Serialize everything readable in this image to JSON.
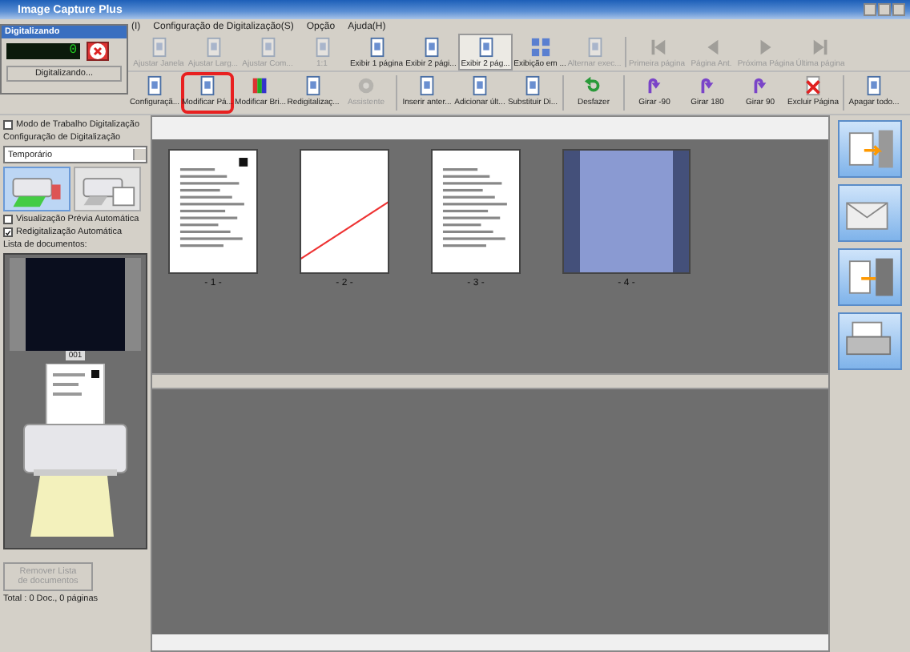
{
  "window": {
    "title": "Image Capture Plus"
  },
  "menu": [
    "(I)",
    "Configuração de Digitalização(S)",
    "Opção",
    "Ajuda(H)"
  ],
  "toolbar_view": [
    {
      "label": "Ajustar Janela",
      "disabled": true,
      "selected": false
    },
    {
      "label": "Ajustar Larg...",
      "disabled": true,
      "selected": false
    },
    {
      "label": "Ajustar Com...",
      "disabled": true,
      "selected": false
    },
    {
      "label": "1:1",
      "disabled": true,
      "selected": false
    },
    {
      "label": "Exibir 1 página",
      "disabled": false,
      "selected": false
    },
    {
      "label": "Exibir 2 pági...",
      "disabled": false,
      "selected": false
    },
    {
      "label": "Exibir 2 pág...",
      "disabled": false,
      "selected": true
    },
    {
      "label": "Exibição em ...",
      "disabled": false,
      "selected": false
    },
    {
      "label": "Alternar exec...",
      "disabled": true,
      "selected": false
    },
    {
      "label": "Primeira página",
      "disabled": true,
      "selected": false
    },
    {
      "label": "Página Ant.",
      "disabled": true,
      "selected": false
    },
    {
      "label": "Próxima Página",
      "disabled": true,
      "selected": false
    },
    {
      "label": "Última página",
      "disabled": true,
      "selected": false
    }
  ],
  "toolbar_edit": [
    {
      "label": "Configuraçã...",
      "disabled": false,
      "marked": false
    },
    {
      "label": "Modificar Pá...",
      "disabled": false,
      "marked": true
    },
    {
      "label": "Modificar Bri...",
      "disabled": false,
      "marked": false
    },
    {
      "label": "Redigitalizaç...",
      "disabled": false,
      "marked": false
    },
    {
      "label": "Assistente",
      "disabled": true,
      "marked": false
    },
    {
      "label": "Inserir anter...",
      "disabled": false,
      "marked": false
    },
    {
      "label": "Adicionar últ...",
      "disabled": false,
      "marked": false
    },
    {
      "label": "Substituir Di...",
      "disabled": false,
      "marked": false
    },
    {
      "label": "Desfazer",
      "disabled": false,
      "marked": false
    },
    {
      "label": "Girar -90",
      "disabled": false,
      "marked": false
    },
    {
      "label": "Girar 180",
      "disabled": false,
      "marked": false
    },
    {
      "label": "Girar 90",
      "disabled": false,
      "marked": false
    },
    {
      "label": "Excluir Página",
      "disabled": false,
      "marked": false
    },
    {
      "label": "Apagar todo...",
      "disabled": false,
      "marked": false
    }
  ],
  "scan_dialog": {
    "title": "Digitalizando",
    "counter": "0",
    "status": "Digitalizando..."
  },
  "sidebar": {
    "work_mode": {
      "label": "Modo de Trabalho Digitalização",
      "checked": false
    },
    "config_label": "Configuração de Digitalização",
    "config_value": "Temporário",
    "modes": [
      {
        "selected": true
      },
      {
        "selected": false
      }
    ],
    "options": [
      {
        "label": "Visualização Prévia Automática",
        "checked": false
      },
      {
        "label": "Redigitalização Automática",
        "checked": true
      }
    ],
    "list_label": "Lista de documentos:",
    "document_number": "001",
    "remove_button": {
      "label": "Remover Lista de documentos",
      "disabled": true
    },
    "total": "Total :  0 Doc.,  0 páginas"
  },
  "pages": [
    {
      "label": "- 1 -",
      "kind": "text",
      "selected": false
    },
    {
      "label": "- 2 -",
      "kind": "blank",
      "selected": false
    },
    {
      "label": "- 3 -",
      "kind": "text",
      "selected": false
    },
    {
      "label": "- 4 -",
      "kind": "scan",
      "selected": true
    }
  ]
}
